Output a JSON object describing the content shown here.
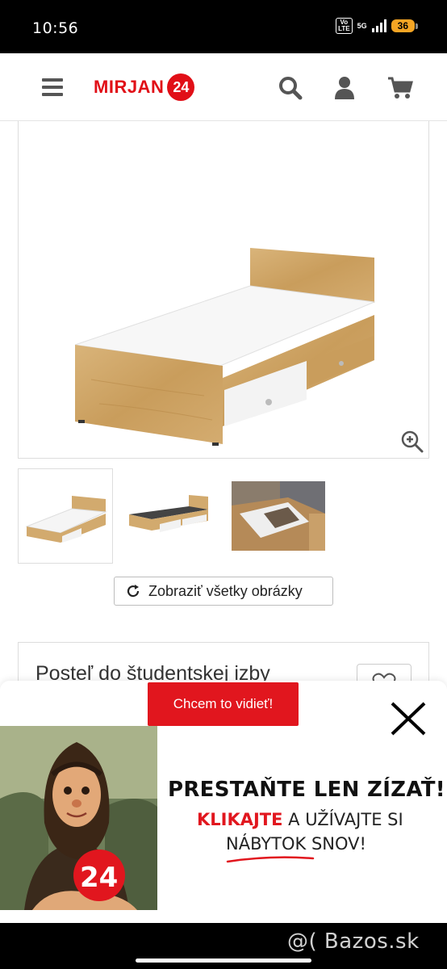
{
  "status_bar": {
    "time": "10:56",
    "volte_label": "Vo\nLTE",
    "network": "5G",
    "battery": "36"
  },
  "header": {
    "logo_text": "MIRJAN",
    "logo_badge": "24"
  },
  "gallery": {
    "show_all_label": "Zobraziť všetky obrázky"
  },
  "product": {
    "title": "Posteľ do študentskej izby"
  },
  "popup": {
    "cta_label": "Chcem to vidieť!",
    "art_badge": "24",
    "headline": "PRESTAŇTE LEN ZÍZAŤ!",
    "line2_highlight": "KLIKAJTE",
    "line2_rest": " A UŽÍVAJTE SI",
    "line3": "NÁBYTOK SNOV!"
  },
  "watermark": "@( Bazos.sk",
  "colors": {
    "brand_red": "#e10f17",
    "battery": "#f5a524"
  },
  "icons": [
    "menu-icon",
    "search-icon",
    "user-icon",
    "cart-icon",
    "zoom-in-icon",
    "refresh-icon",
    "heart-icon",
    "close-icon"
  ]
}
